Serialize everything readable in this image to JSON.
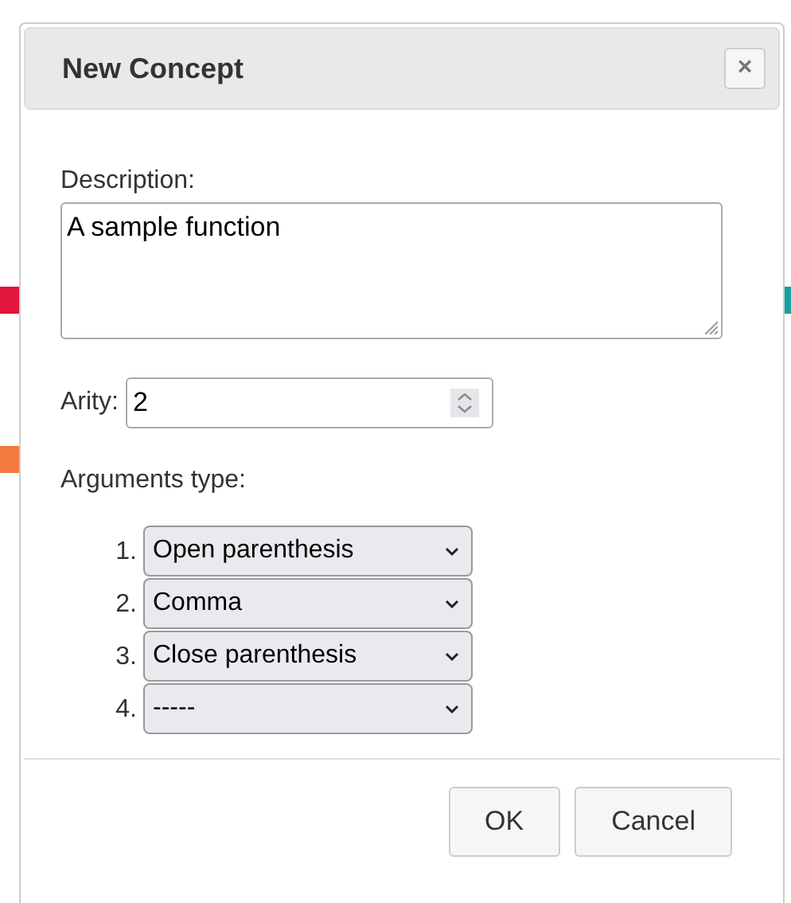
{
  "dialog": {
    "title": "New Concept",
    "close": "×"
  },
  "description": {
    "label": "Description:",
    "value": "A sample function"
  },
  "arity": {
    "label": "Arity:",
    "value": "2"
  },
  "arguments": {
    "label": "Arguments type:",
    "items": [
      {
        "number": "1.",
        "value": "Open parenthesis"
      },
      {
        "number": "2.",
        "value": "Comma"
      },
      {
        "number": "3.",
        "value": "Close parenthesis"
      },
      {
        "number": "4.",
        "value": "-----"
      }
    ]
  },
  "buttons": [
    {
      "label": "OK"
    },
    {
      "label": "Cancel"
    }
  ]
}
